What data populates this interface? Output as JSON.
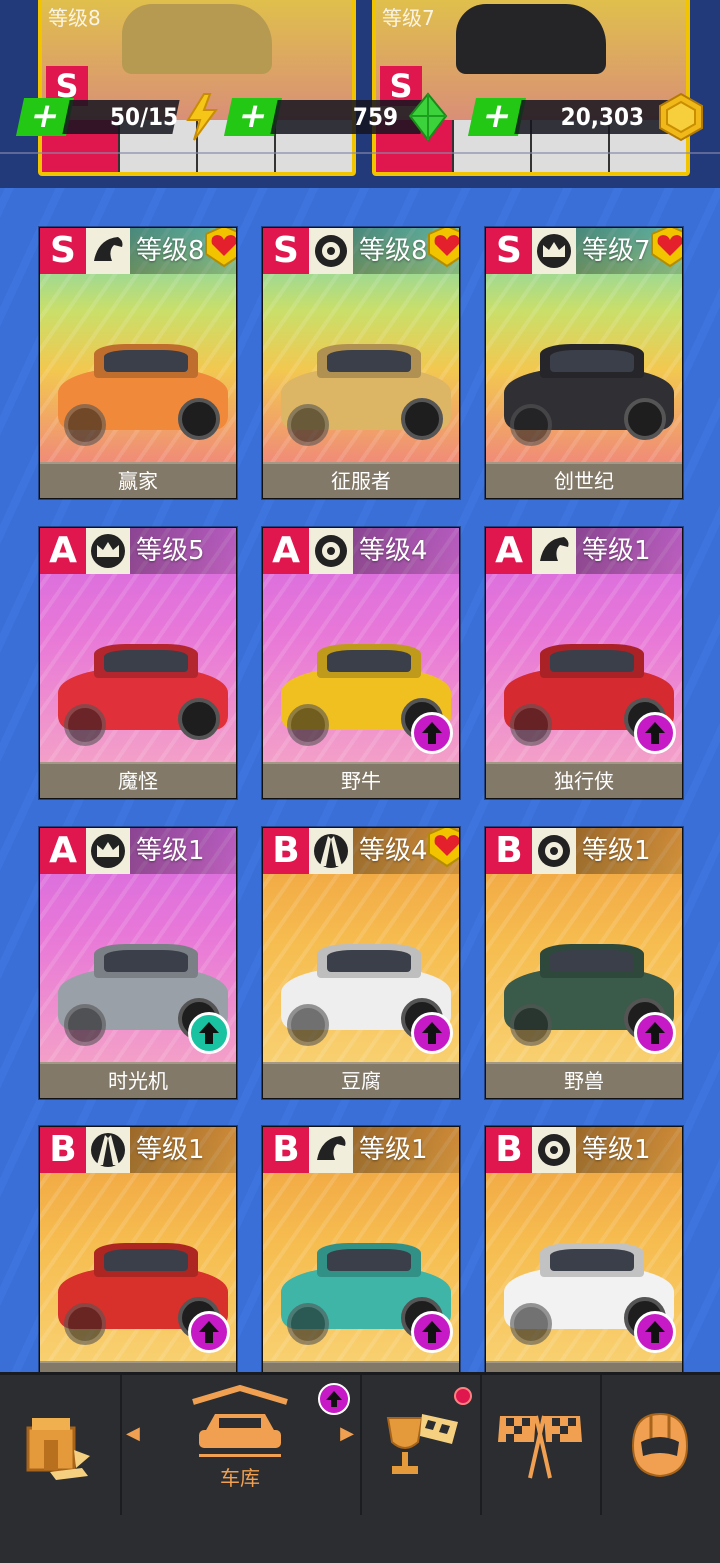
{
  "top_strip": {
    "peek_cards": [
      {
        "level": "等级8",
        "class": "S"
      },
      {
        "level": "等级7",
        "class": "S"
      }
    ]
  },
  "currency": {
    "energy": {
      "value": "50/15",
      "icon": "lightning-icon",
      "color": "#f5c518"
    },
    "gems": {
      "value": "759",
      "icon": "gem-icon",
      "color": "#3cd23c"
    },
    "coins": {
      "value": "20,303",
      "icon": "coin-icon",
      "color": "#f0b818"
    },
    "add_color": "#22c814"
  },
  "cars": [
    {
      "class": "S",
      "type": "horse-icon",
      "level": "等级8",
      "name": "赢家",
      "favorite": true,
      "upgrade": false,
      "bg": "rainbow",
      "car_color": "#f08a3a"
    },
    {
      "class": "S",
      "type": "wheel-icon",
      "level": "等级8",
      "name": "征服者",
      "favorite": true,
      "upgrade": false,
      "bg": "rainbow",
      "car_color": "#dcb565"
    },
    {
      "class": "S",
      "type": "crown-icon",
      "level": "等级7",
      "name": "创世纪",
      "favorite": true,
      "upgrade": false,
      "bg": "rainbow",
      "car_color": "#2f2f34"
    },
    {
      "class": "A",
      "type": "crown-icon",
      "level": "等级5",
      "name": "魔怪",
      "favorite": false,
      "upgrade": false,
      "bg": "pink",
      "car_color": "#e0303a"
    },
    {
      "class": "A",
      "type": "wheel-icon",
      "level": "等级4",
      "name": "野牛",
      "favorite": false,
      "upgrade": true,
      "bg": "pink",
      "car_color": "#f0c020"
    },
    {
      "class": "A",
      "type": "horse-icon",
      "level": "等级1",
      "name": "独行侠",
      "favorite": false,
      "upgrade": true,
      "bg": "pink",
      "car_color": "#d42a30"
    },
    {
      "class": "A",
      "type": "crown-icon",
      "level": "等级1",
      "name": "时光机",
      "favorite": false,
      "upgrade": true,
      "bg": "pink",
      "car_color": "#9aa0a8",
      "upgrade_color": "#19c2a0"
    },
    {
      "class": "B",
      "type": "road-icon",
      "level": "等级4",
      "name": "豆腐",
      "favorite": true,
      "upgrade": true,
      "bg": "orange",
      "car_color": "#eeeeee"
    },
    {
      "class": "B",
      "type": "wheel-icon",
      "level": "等级1",
      "name": "野兽",
      "favorite": false,
      "upgrade": true,
      "bg": "orange",
      "car_color": "#3a5a4a"
    },
    {
      "class": "B",
      "type": "road-icon",
      "level": "等级1",
      "name": "",
      "favorite": false,
      "upgrade": true,
      "bg": "orange",
      "car_color": "#d8302a"
    },
    {
      "class": "B",
      "type": "horse-icon",
      "level": "等级1",
      "name": "",
      "favorite": false,
      "upgrade": true,
      "bg": "orange",
      "car_color": "#3fb5a8"
    },
    {
      "class": "B",
      "type": "wheel-icon",
      "level": "等级1",
      "name": "",
      "favorite": false,
      "upgrade": true,
      "bg": "orange",
      "car_color": "#f2f2f2"
    }
  ],
  "colors": {
    "class_badge": "#e0174f",
    "favorite": "#e3202c",
    "upgrade": "#c51ac5",
    "nav_accent": "#f0a050"
  },
  "nav": {
    "items": [
      {
        "id": "shop",
        "icon": "crate-icon"
      },
      {
        "id": "garage",
        "icon": "garage-car-icon",
        "label": "车库",
        "upgrade_badge": true
      },
      {
        "id": "trophy",
        "icon": "trophy-flag-icon",
        "notification": true
      },
      {
        "id": "race",
        "icon": "checkered-flags-icon"
      },
      {
        "id": "profile",
        "icon": "helmet-icon"
      }
    ]
  }
}
